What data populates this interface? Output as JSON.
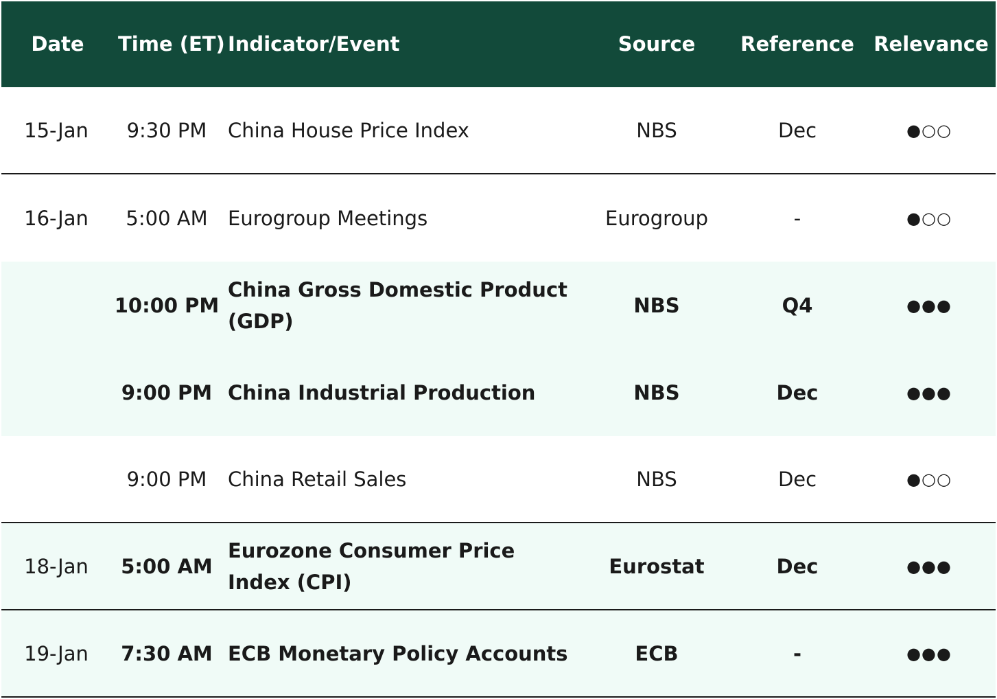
{
  "header": {
    "date": "Date",
    "time": "Time (ET)",
    "event": "Indicator/Event",
    "source": "Source",
    "reference": "Reference",
    "relevance": "Relevance"
  },
  "colors": {
    "header_bg": "#124a3a",
    "highlight_bg": "#f0fbf7",
    "text": "#1a1a1a"
  },
  "rows": [
    {
      "date": "15-Jan",
      "time": "9:30 PM",
      "event": "China House Price Index",
      "source": "NBS",
      "reference": "Dec",
      "relevance": "●○○",
      "bold": false
    },
    {
      "date": "16-Jan",
      "time": "5:00 AM",
      "event": "Eurogroup Meetings",
      "source": "Eurogroup",
      "reference": "-",
      "relevance": "●○○",
      "bold": false
    },
    {
      "date": "",
      "time": "10:00 PM",
      "event": "China Gross Domestic Product (GDP)",
      "source": "NBS",
      "reference": "Q4",
      "relevance": "●●●",
      "bold": true
    },
    {
      "date": "",
      "time": "9:00 PM",
      "event": "China Industrial Production",
      "source": "NBS",
      "reference": "Dec",
      "relevance": "●●●",
      "bold": true
    },
    {
      "date": "",
      "time": "9:00 PM",
      "event": "China Retail Sales",
      "source": "NBS",
      "reference": "Dec",
      "relevance": "●○○",
      "bold": false
    },
    {
      "date": "18-Jan",
      "time": "5:00 AM",
      "event": "Eurozone Consumer Price Index (CPI)",
      "source": "Eurostat",
      "reference": "Dec",
      "relevance": "●●●",
      "bold": true
    },
    {
      "date": "19-Jan",
      "time": "7:30 AM",
      "event": "ECB Monetary Policy Accounts",
      "source": "ECB",
      "reference": "-",
      "relevance": "●●●",
      "bold": true
    }
  ]
}
